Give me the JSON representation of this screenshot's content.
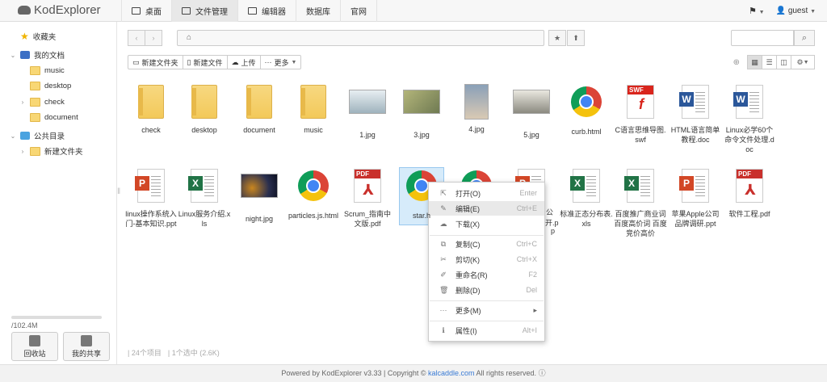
{
  "brand": "KodExplorer",
  "nav": [
    {
      "label": "桌面",
      "active": false
    },
    {
      "label": "文件管理",
      "active": true
    },
    {
      "label": "编辑器",
      "active": false
    },
    {
      "label": "数据库",
      "active": false
    },
    {
      "label": "官网",
      "active": false
    }
  ],
  "user": "guest",
  "sidebar": {
    "favorites": "收藏夹",
    "my_docs": "我的文档",
    "my_docs_children": [
      "music",
      "desktop",
      "check",
      "document"
    ],
    "public": "公共目录",
    "public_children": [
      "新建文件夹"
    ],
    "quota": "/102.4M",
    "recycle": "回收站",
    "share": "我的共享"
  },
  "toolbar": {
    "new_folder": "新建文件夹",
    "new_file": "新建文件",
    "upload": "上传",
    "more": "更多"
  },
  "files": [
    {
      "name": "check",
      "type": "folder"
    },
    {
      "name": "desktop",
      "type": "folder"
    },
    {
      "name": "document",
      "type": "folder"
    },
    {
      "name": "music",
      "type": "folder"
    },
    {
      "name": "1.jpg",
      "type": "image"
    },
    {
      "name": "3.jpg",
      "type": "image"
    },
    {
      "name": "4.jpg",
      "type": "image-tall"
    },
    {
      "name": "5.jpg",
      "type": "image"
    },
    {
      "name": "curb.html",
      "type": "chrome"
    },
    {
      "name": "C语言思维导图.swf",
      "type": "swf"
    },
    {
      "name": "HTML语言简单教程.doc",
      "type": "word"
    },
    {
      "name": "Linux必学60个命令文件处理.doc",
      "type": "word"
    },
    {
      "name": "linux操作系统入门-基本知识.ppt",
      "type": "ppt"
    },
    {
      "name": "Linux服务介绍.xls",
      "type": "excel"
    },
    {
      "name": "night.jpg",
      "type": "image"
    },
    {
      "name": "particles.js.html",
      "type": "chrome"
    },
    {
      "name": "Scrum_指南中文版.pdf",
      "type": "pdf"
    },
    {
      "name": "star.h",
      "type": "chrome",
      "selected": true
    },
    {
      "name": "",
      "type": "chrome"
    },
    {
      "name": "",
      "type": "ppt"
    },
    {
      "name": "标准正态分布表.xls",
      "type": "excel"
    },
    {
      "name": "百度推广商业词 百度高价词 百度竞价高价",
      "type": "excel"
    },
    {
      "name": "苹果Apple公司品牌调研.ppt",
      "type": "ppt"
    },
    {
      "name": "软件工程.pdf",
      "type": "pdf"
    }
  ],
  "partial_labels": {
    "p19": "公",
    "p19b": "p",
    "p20": "开.p"
  },
  "context_menu": [
    {
      "label": "打开(O)",
      "key": "Enter",
      "icon": "open-icon"
    },
    {
      "label": "编辑(E)",
      "key": "Ctrl+E",
      "icon": "edit-icon"
    },
    {
      "label": "下载(X)",
      "key": "",
      "icon": "download-icon"
    },
    {
      "label": "复制(C)",
      "key": "Ctrl+C",
      "icon": "copy-icon"
    },
    {
      "label": "剪切(K)",
      "key": "Ctrl+X",
      "icon": "cut-icon"
    },
    {
      "label": "重命名(R)",
      "key": "F2",
      "icon": "rename-icon"
    },
    {
      "label": "删除(D)",
      "key": "Del",
      "icon": "trash-icon"
    },
    {
      "label": "更多(M)",
      "key": "",
      "icon": "more-icon"
    },
    {
      "label": "属性(I)",
      "key": "Alt+I",
      "icon": "info-icon"
    }
  ],
  "status": {
    "count": "24个项目",
    "selected": "1个选中 (2.6K)"
  },
  "footer": {
    "prefix": "Powered by KodExplorer v3.33 | Copyright ©",
    "link": "kalcaddle.com",
    "suffix": "All rights reserved."
  },
  "colors": {
    "accent": "#3a7bd5",
    "folder": "#f3c95a",
    "selected": "#d6ebfa"
  }
}
